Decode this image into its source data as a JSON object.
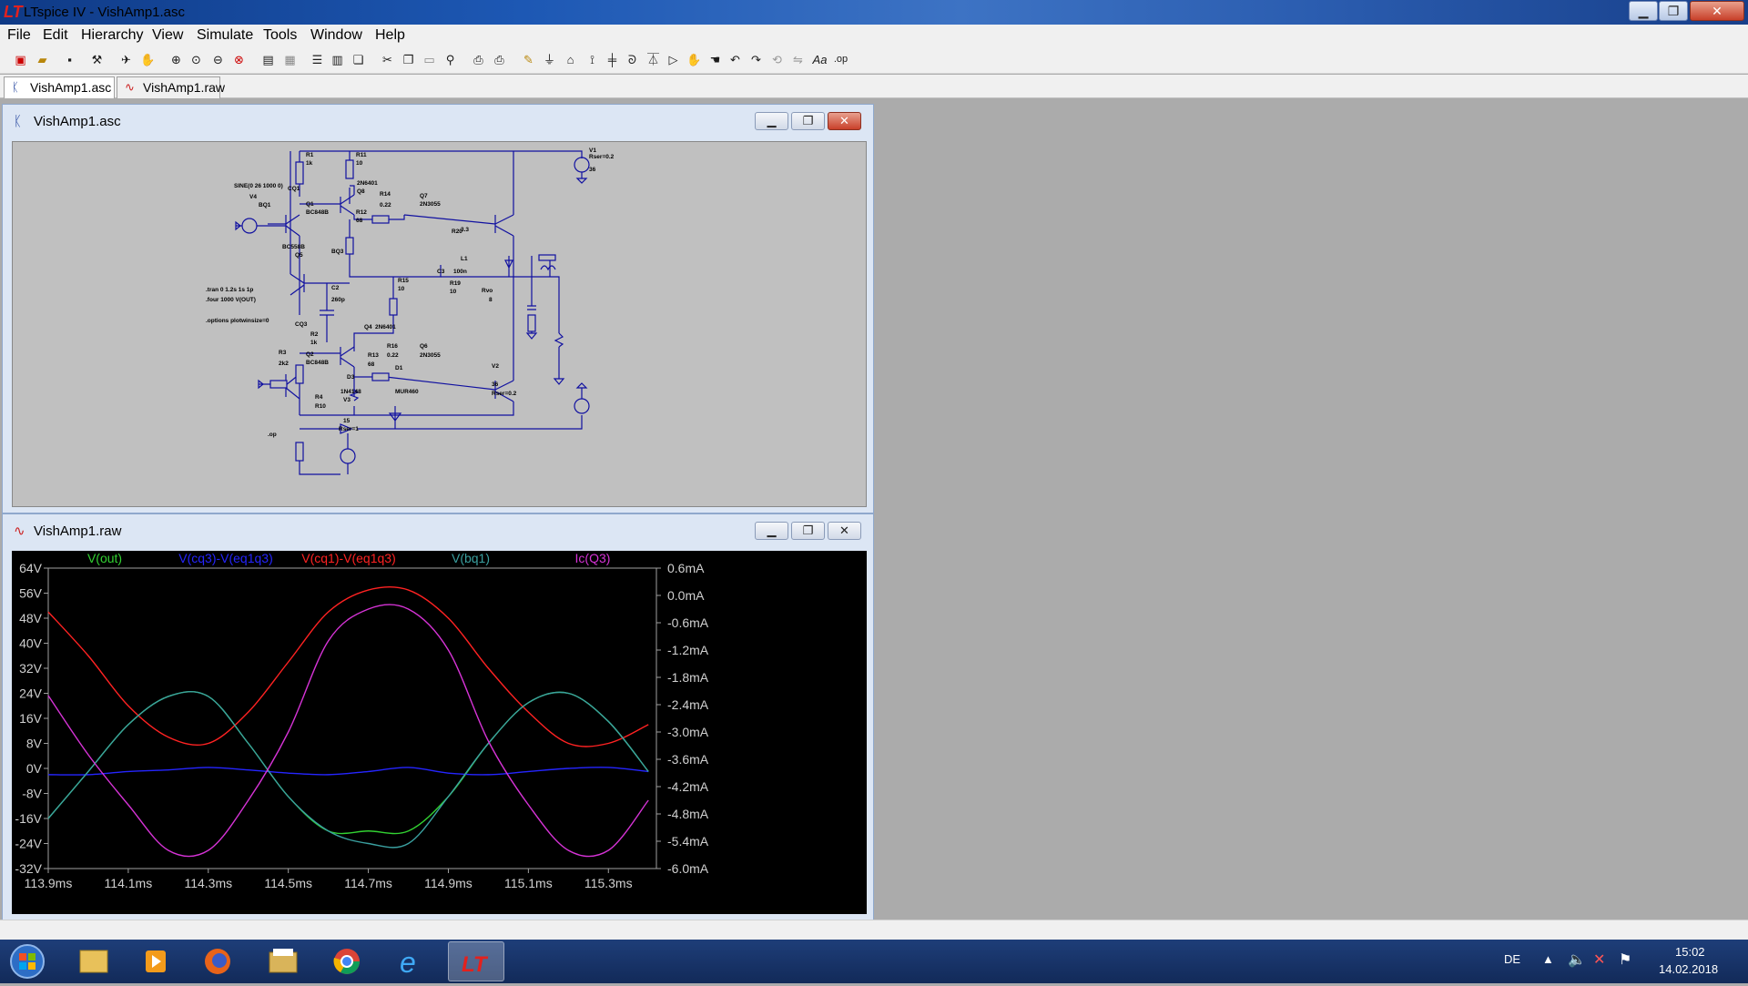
{
  "window": {
    "title": "LTspice IV - VishAmp1.asc",
    "min": "▁",
    "max": "❐",
    "close": "✕"
  },
  "menu": [
    "File",
    "Edit",
    "Hierarchy",
    "View",
    "Simulate",
    "Tools",
    "Window",
    "Help"
  ],
  "toolbar_icons": [
    "new-schematic",
    "open",
    "save",
    "control-panel",
    "run",
    "halt",
    "zoom-in",
    "pan",
    "zoom-out",
    "zoom-fit",
    "autorange",
    "grid",
    "view-netlist",
    "tile-horizontal",
    "tile-vertical",
    "cascade",
    "cut",
    "copy",
    "paste",
    "find",
    "print-preview",
    "print",
    "wire",
    "ground",
    "label-net",
    "resistor",
    "capacitor",
    "inductor",
    "diode",
    "component",
    "move",
    "drag",
    "undo",
    "redo",
    "rotate",
    "mirror",
    "text",
    "spice-directive"
  ],
  "tabs": [
    {
      "label": "VishAmp1.asc",
      "icon": "schematic-icon"
    },
    {
      "label": "VishAmp1.raw",
      "icon": "waveform-icon"
    }
  ],
  "schematic_window": {
    "title": "VishAmp1.asc"
  },
  "waveform_window": {
    "title": "VishAmp1.raw"
  },
  "schematic": {
    "labels": {
      "r1": "R1",
      "r1v": "1k",
      "r11": "R11",
      "r11v": "10",
      "v1": "V1",
      "v1r": "Rser=0.2",
      "v1v": "36",
      "sine": "SINE(0 26 1000 0)",
      "v4": "V4",
      "bq1": "BQ1",
      "cq1": "CQ1",
      "q1": "Q1",
      "q1m": "BC848B",
      "q8m": "2N6401",
      "q8": "Q8",
      "r14": "R14",
      "r14v": "0.22",
      "q7": "Q7",
      "q7m": "2N3055",
      "r12": "R12",
      "r12v": "68",
      "r20": "R20",
      "r20v": "3.3",
      "l1": "L1",
      "c3": "C3",
      "c3v": "100n",
      "r19": "R19",
      "r19v": "10",
      "rvo": "Rvo",
      "rvov": "8",
      "q5m": "BC558B",
      "q5": "Q5",
      "bq3": "BQ3",
      "c2": "C2",
      "c2v": "260p",
      "r15": "R15",
      "r15v": "10",
      "tran": ".tran 0 1.2s 1s 1p",
      "four": ".four 1000 V(OUT)",
      "options": ".options plotwinsize=0",
      "cq3": "CQ3",
      "r2": "R2",
      "r2v": "1k",
      "q4": "Q4",
      "q4m": "2N6401",
      "r3": "R3",
      "r3v": "2k2",
      "q2": "Q2",
      "q2m": "BC848B",
      "r13": "R13",
      "r13v": "68",
      "r16": "R16",
      "r16v": "0.22",
      "q6": "Q6",
      "q6m": "2N3055",
      "v2": "V2",
      "v2v": "36",
      "v2r": "Rser=0.2",
      "d1": "D1",
      "d1m": "MUR460",
      "d3": "D3",
      "d3m": "1N4148",
      "r4": "R4",
      "r4v": "R10",
      "v3": "V3",
      "v3v": "15",
      "v3r": "Rser=1",
      "op": ".op"
    }
  },
  "chart_data": {
    "type": "line",
    "title": "",
    "xlabel": "",
    "ylabel": "",
    "x": [
      113.9,
      114.0,
      114.1,
      114.2,
      114.3,
      114.4,
      114.5,
      114.6,
      114.7,
      114.8,
      114.9,
      115.0,
      115.1,
      115.2,
      115.3,
      115.4
    ],
    "x_ticks": [
      "113.9ms",
      "114.1ms",
      "114.3ms",
      "114.5ms",
      "114.7ms",
      "114.9ms",
      "115.1ms",
      "115.3ms"
    ],
    "xlim": [
      113.9,
      115.42
    ],
    "y_left_ticks": [
      "64V",
      "56V",
      "48V",
      "40V",
      "32V",
      "24V",
      "16V",
      "8V",
      "0V",
      "-8V",
      "-16V",
      "-24V",
      "-32V"
    ],
    "ylim_left": [
      -32,
      64
    ],
    "y_right_ticks": [
      "0.6mA",
      "0.0mA",
      "-0.6mA",
      "-1.2mA",
      "-1.8mA",
      "-2.4mA",
      "-3.0mA",
      "-3.6mA",
      "-4.2mA",
      "-4.8mA",
      "-5.4mA",
      "-6.0mA"
    ],
    "ylim_right": [
      -6.0,
      0.6
    ],
    "grid": false,
    "series": [
      {
        "name": "V(out)",
        "axis": "left",
        "color": "#32d232",
        "values": [
          -16,
          -1,
          14,
          23,
          23,
          8,
          -9,
          -20,
          -20,
          -20,
          -9,
          8,
          21,
          24,
          15,
          -1
        ]
      },
      {
        "name": "V(cq3)-V(eq1q3)",
        "axis": "left",
        "color": "#2525ff",
        "values": [
          -2,
          -2,
          -1,
          -0.5,
          0.3,
          -0.5,
          -1.5,
          -2,
          -1,
          0.3,
          -1.5,
          -2,
          -1,
          0,
          0.3,
          -1
        ]
      },
      {
        "name": "V(cq1)-V(eq1q3)",
        "axis": "left",
        "color": "#ff2222",
        "values": [
          50,
          36,
          20,
          10,
          8,
          18,
          34,
          50,
          57,
          57,
          48,
          32,
          18,
          8,
          8,
          14
        ]
      },
      {
        "name": "V(bq1)",
        "axis": "left",
        "color": "#3aa0a0",
        "values": [
          -16,
          -1,
          14,
          23,
          23,
          8,
          -9,
          -20,
          -24,
          -24,
          -9,
          8,
          21,
          24,
          15,
          -1
        ]
      },
      {
        "name": "Ic(Q3)",
        "axis": "right",
        "color": "#d633d6",
        "values": [
          -2.2,
          -3.5,
          -4.6,
          -5.6,
          -5.6,
          -4.5,
          -3.0,
          -1.0,
          -0.3,
          -0.3,
          -1.2,
          -3.2,
          -4.6,
          -5.6,
          -5.6,
          -4.5
        ]
      }
    ]
  },
  "taskbar": {
    "apps": [
      "start-orb",
      "explorer-icon",
      "media-player-icon",
      "firefox-icon",
      "file-manager-icon",
      "chrome-icon",
      "ie-icon",
      "ltspice-icon"
    ],
    "lang": "DE",
    "time": "15:02",
    "date": "14.02.2018"
  }
}
